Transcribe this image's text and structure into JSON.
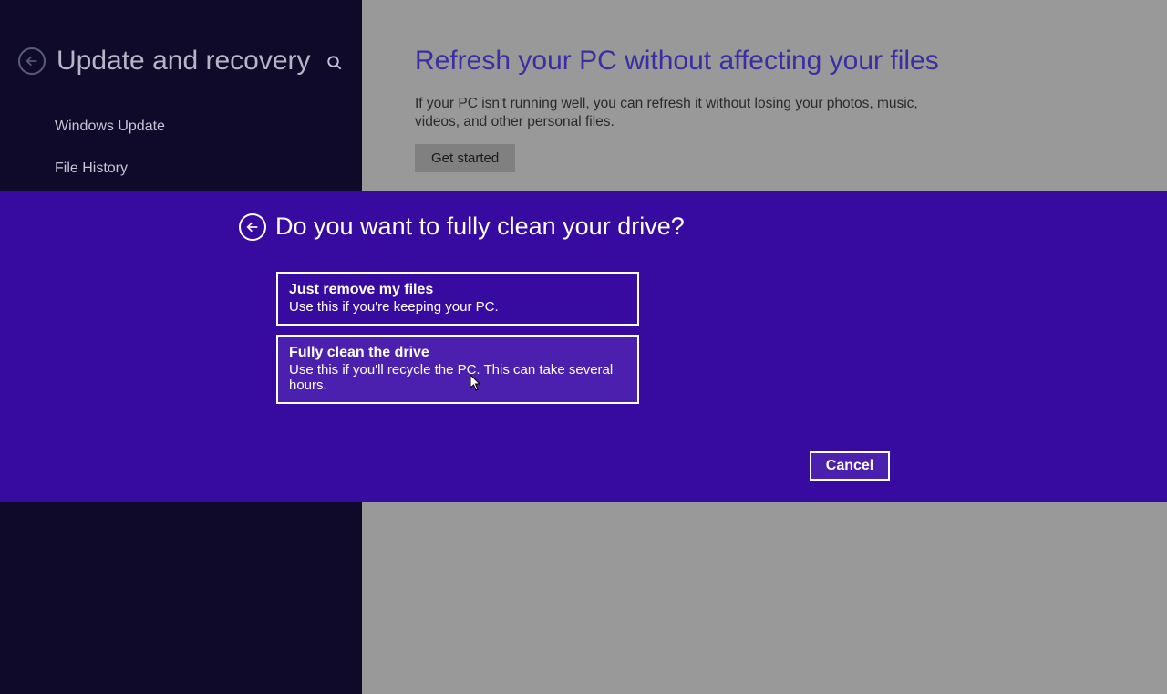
{
  "sidebar": {
    "title": "Update and recovery",
    "items": [
      "Windows Update",
      "File History"
    ]
  },
  "content": {
    "title": "Refresh your PC without affecting your files",
    "description": "If your PC isn't running well, you can refresh it without losing your photos, music, videos, and other personal files.",
    "get_started_label": "Get started"
  },
  "modal": {
    "title": "Do you want to fully clean your drive?",
    "options": [
      {
        "title": "Just remove my files",
        "desc": "Use this if you're keeping your PC."
      },
      {
        "title": "Fully clean the drive",
        "desc": "Use this if you'll recycle the PC. This can take several hours."
      }
    ],
    "cancel_label": "Cancel"
  }
}
